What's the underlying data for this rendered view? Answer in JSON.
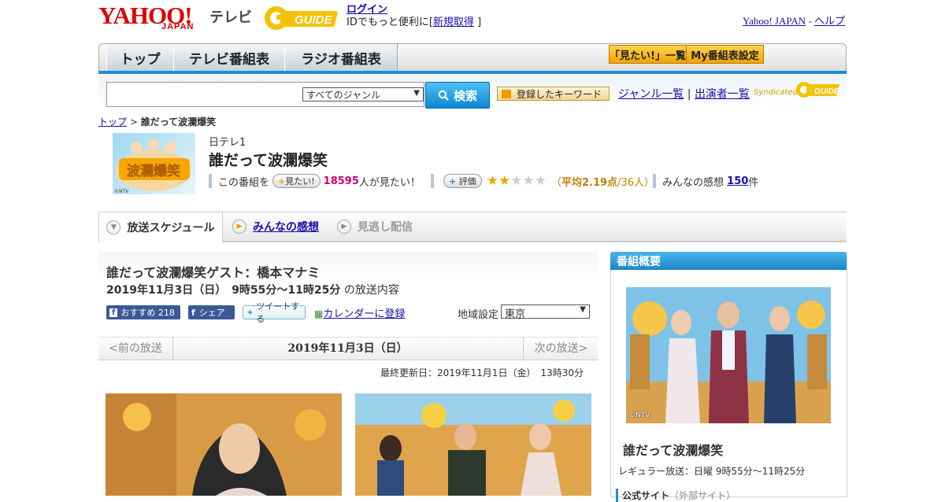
{
  "header": {
    "logo_main": "YAHOO!",
    "logo_sub": "JAPAN",
    "logo_tv": "テレビ",
    "gguide": "GUIDE",
    "login": "ログイン",
    "login_sub": "IDでもっと便利に[",
    "signup": "新規取得",
    "login_close": "]",
    "yahoo_japan": "Yahoo! JAPAN",
    "sep": " - ",
    "help": "ヘルプ"
  },
  "nav": {
    "tabs": [
      "トップ",
      "テレビ番組表",
      "ラジオ番組表"
    ],
    "want_list": "「見たい!」一覧",
    "my_schedule": "My番組表設定"
  },
  "search": {
    "genre": "すべてのジャンル",
    "button": "検索",
    "keyword_btn": "登録したキーワード",
    "genre_list": "ジャンル一覧",
    "divider": " | ",
    "cast_list": "出演者一覧",
    "syndicated": "Syndicated"
  },
  "breadcrumb": {
    "top": "トップ",
    "sep": " > ",
    "current": "誰だって波瀾爆笑"
  },
  "program": {
    "channel": "日テレ1",
    "title": "誰だって波瀾爆笑",
    "thumb_text": "波瀾爆笑",
    "want_prefix": "この番組を",
    "want_btn": "見たい!",
    "want_count": "18595",
    "want_suffix": "人が見たい！",
    "rate_btn": "評価",
    "rating_text": "（平均2.19点/36人）",
    "rating_avg": "平均2.19点",
    "rating_open": "（",
    "rating_rest": "/36人）",
    "comments_label": "みんなの感想",
    "comments_count": "150",
    "comments_unit": "件",
    "rating_stars": 2
  },
  "subtabs": [
    "放送スケジュール",
    "みんなの感想",
    "見逃し配信"
  ],
  "episode": {
    "title": "誰だって波瀾爆笑ゲスト：橋本マナミ",
    "date": "2019年11月3日（日）　9時55分～11時25分",
    "date_suffix": "の放送内容",
    "fb_recommend": "おすすめ",
    "fb_count": "218",
    "fb_share": "シェア",
    "tweet": "ツイートする",
    "calendar": "カレンダーに登録",
    "region_label": "地域設定",
    "region_value": "東京",
    "prev": "<前の放送",
    "current_date": "2019年11月3日（日）",
    "next": "次の放送>",
    "updated": "最終更新日：2019年11月1日（金）　13時30分"
  },
  "right_panel": {
    "heading": "番組概要",
    "title": "誰だって波瀾爆笑",
    "regular": "レギュラー放送：日曜 9時55分～11時25分",
    "site": "公式サイト",
    "site_note": "（外部サイト）",
    "credit": "©NTV"
  },
  "colors": {
    "accent": "#1d8fd3",
    "brand_red": "#dd0000",
    "pink": "#d4006a",
    "star": "#f0a400"
  }
}
